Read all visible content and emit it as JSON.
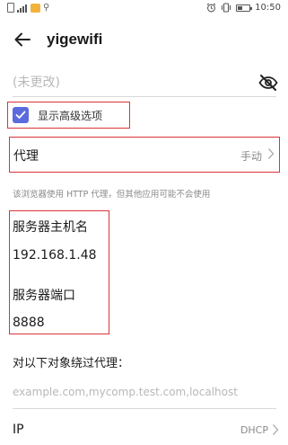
{
  "status_bar": {
    "time": "10:50",
    "icons": [
      "sim-icon",
      "signal-icon",
      "message-icon",
      "location-icon",
      "alarm-icon",
      "vibrate-icon",
      "battery-icon"
    ]
  },
  "header": {
    "title": "yigewifi"
  },
  "password": {
    "placeholder": "(未更改)"
  },
  "advanced": {
    "label": "显示高级选项",
    "checked": true,
    "accent_color": "#5b6bde"
  },
  "proxy": {
    "label": "代理",
    "value": "手动"
  },
  "hint": "该浏览器使用 HTTP 代理，但其他应用可能不会使用",
  "server": {
    "host_label": "服务器主机名",
    "host_value": "192.168.1.48",
    "port_label": "服务器端口",
    "port_value": "8888"
  },
  "bypass": {
    "label": "对以下对象绕过代理：",
    "placeholder": "example.com,mycomp.test.com,localhost"
  },
  "ip": {
    "label": "IP",
    "value": "DHCP"
  },
  "highlight_color": "#d9343a"
}
